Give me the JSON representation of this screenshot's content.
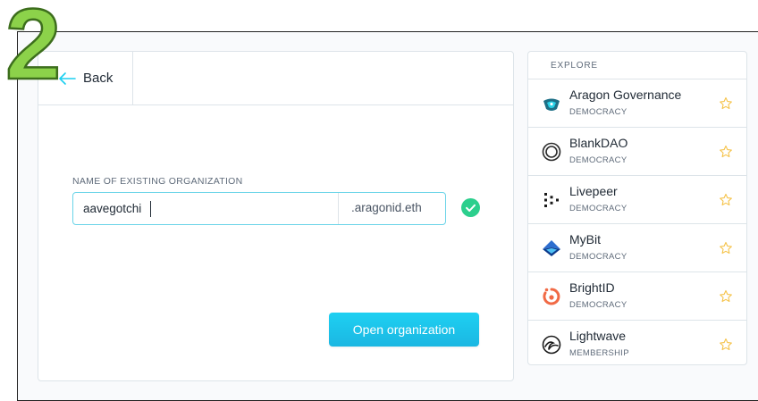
{
  "step_badge": "2",
  "back": {
    "label": "Back"
  },
  "form": {
    "label": "NAME OF EXISTING ORGANIZATION",
    "value": "aavegotchi",
    "suffix": ".aragonid.eth",
    "submit_label": "Open organization"
  },
  "explore": {
    "title": "EXPLORE",
    "items": [
      {
        "name": "Aragon Governance",
        "type": "DEMOCRACY",
        "logo": "aragon-logo"
      },
      {
        "name": "BlankDAO",
        "type": "DEMOCRACY",
        "logo": "blankdao-logo"
      },
      {
        "name": "Livepeer",
        "type": "DEMOCRACY",
        "logo": "livepeer-logo"
      },
      {
        "name": "MyBit",
        "type": "DEMOCRACY",
        "logo": "mybit-logo"
      },
      {
        "name": "BrightID",
        "type": "DEMOCRACY",
        "logo": "brightid-logo"
      },
      {
        "name": "Lightwave",
        "type": "MEMBERSHIP",
        "logo": "lightwave-logo"
      }
    ]
  },
  "colors": {
    "accent": "#1ccff0",
    "success": "#2ccf8d",
    "star": "#f5c34b",
    "step_badge": "#8cd24a"
  }
}
